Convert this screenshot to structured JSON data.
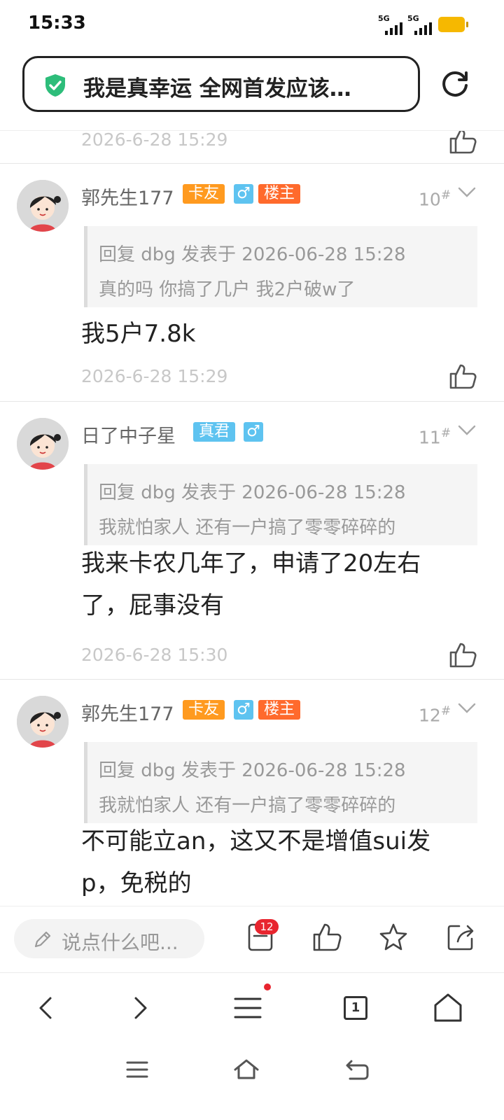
{
  "status": {
    "time": "15:33",
    "sig1": "5G",
    "sig2": "5G"
  },
  "browser": {
    "title": "我是真幸运 全网首发应该…"
  },
  "prev": {
    "timestamp": "2026-6-28 15:29"
  },
  "posts": [
    {
      "username": "郭先生177",
      "badges": [
        "卡友",
        "♂",
        "楼主"
      ],
      "floor": "10",
      "floor_mark": "#",
      "quote_line1": "回复 dbg 发表于 2026-06-28 15:28",
      "quote_line2": "真的吗 你搞了几户 我2户破w了",
      "body_line1": "我5户7.8k",
      "body_line2": "",
      "timestamp": "2026-6-28 15:29"
    },
    {
      "username": "日了中子星",
      "badges": [
        "真君",
        "♂"
      ],
      "floor": "11",
      "floor_mark": "#",
      "quote_line1": "回复 dbg 发表于 2026-06-28 15:28",
      "quote_line2": "我就怕家人 还有一户搞了零零碎碎的",
      "body_line1": "我来卡农几年了，申请了20左右",
      "body_line2": "了，屁事没有",
      "timestamp": "2026-6-28 15:30"
    },
    {
      "username": "郭先生177",
      "badges": [
        "卡友",
        "♂",
        "楼主"
      ],
      "floor": "12",
      "floor_mark": "#",
      "quote_line1": "回复 dbg 发表于 2026-06-28 15:28",
      "quote_line2": "我就怕家人 还有一户搞了零零碎碎的",
      "body_line1": "不可能立an，这又不是增值sui发",
      "body_line2": "p，免税的",
      "timestamp": ""
    }
  ],
  "actionbar": {
    "placeholder": "说点什么吧...",
    "comment_count": "12"
  },
  "nav": {
    "tabs_count": "1"
  },
  "colors": {
    "badge_orange": "#ff9a1f",
    "badge_red": "#ff6a2c",
    "badge_blue": "#5ec3f0",
    "shield_green": "#2dbd7a",
    "battery": "#f6b800"
  },
  "icons": [
    "shield-check-icon",
    "reload-icon",
    "thumbs-up-icon",
    "chevron-down-icon",
    "pen-icon",
    "comments-icon",
    "star-icon",
    "share-icon",
    "back-icon",
    "forward-icon",
    "menu-icon",
    "tabs-icon",
    "home-icon"
  ]
}
